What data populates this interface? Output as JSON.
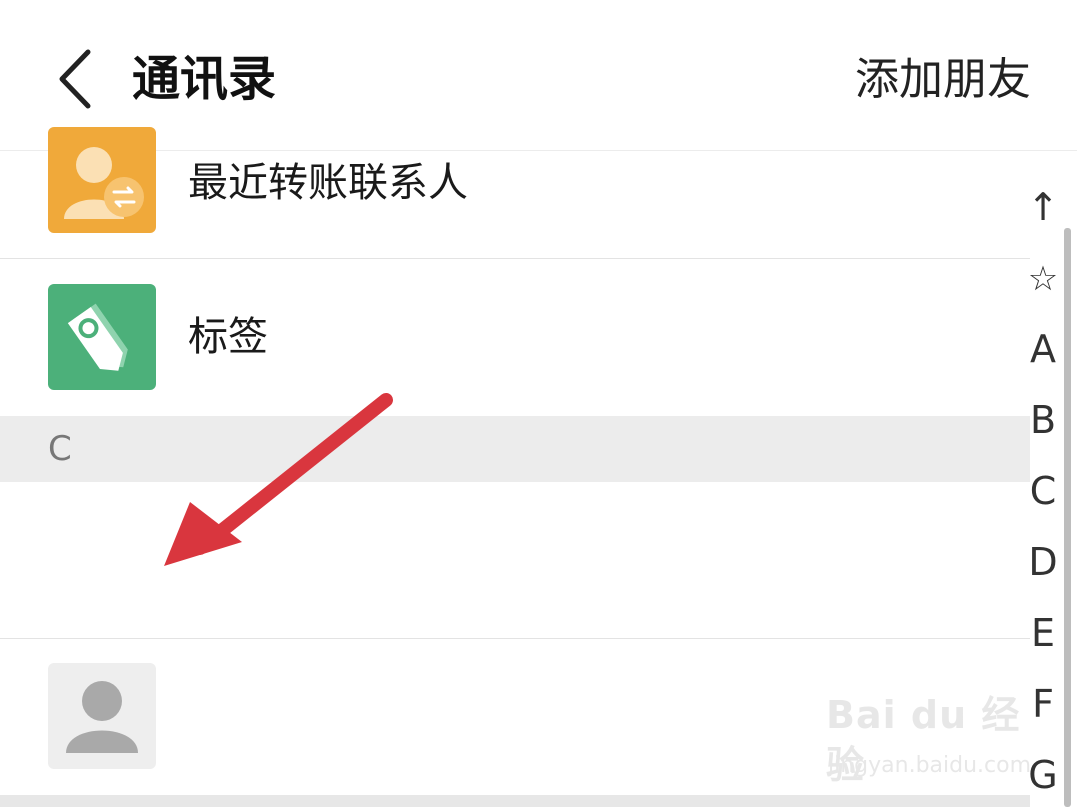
{
  "header": {
    "back_icon": "chevron-left-icon",
    "title": "通讯录",
    "add_friend_label": "添加朋友"
  },
  "rows": {
    "recent_transfer": {
      "label": "最近转账联系人",
      "icon": "person-transfer-icon",
      "icon_color": "#F0A93A"
    },
    "tags": {
      "label": "标签",
      "icon": "tag-icon",
      "icon_color": "#4CB07A"
    }
  },
  "section": {
    "letter": "C"
  },
  "contacts": [
    {
      "label": "",
      "avatar": "default-avatar-icon"
    }
  ],
  "index_bar": {
    "items": [
      "↑",
      "☆",
      "A",
      "B",
      "C",
      "D",
      "E",
      "F",
      "G"
    ]
  },
  "annotation": {
    "arrow_color": "#D9363E"
  },
  "watermark": {
    "main": "Bai du 经验",
    "sub": "jingyan.baidu.com"
  }
}
